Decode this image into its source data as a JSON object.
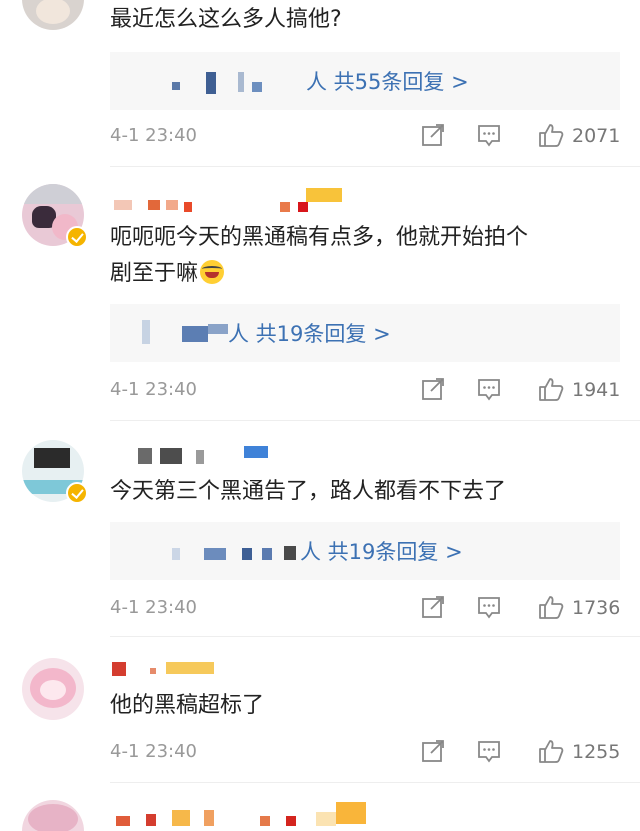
{
  "comments": [
    {
      "text": "最近怎么这么多人搞他?",
      "reply_link": "人 共55条回复 >",
      "time": "4-1 23:40",
      "likes": "2071"
    },
    {
      "text": "呃呃呃今天的黑通稿有点多，他就开始拍个",
      "text2": "剧至于嘛",
      "reply_link": "人 共19条回复 >",
      "time": "4-1 23:40",
      "likes": "1941"
    },
    {
      "text": "今天第三个黑通告了，路人都看不下去了",
      "reply_link": "人 共19条回复 >",
      "time": "4-1 23:40",
      "likes": "1736"
    },
    {
      "text": "他的黑稿超标了",
      "time": "4-1 23:40",
      "likes": "1255"
    }
  ],
  "icons": {
    "share": "share-icon",
    "comment": "comment-icon",
    "like": "thumbs-up-icon",
    "emoji": "laughing-emoji-icon",
    "verified": "verified-badge-icon"
  },
  "colors": {
    "link": "#3c71b3",
    "meta": "#999999",
    "text": "#222222",
    "reply_bg": "#f7f7f7"
  }
}
